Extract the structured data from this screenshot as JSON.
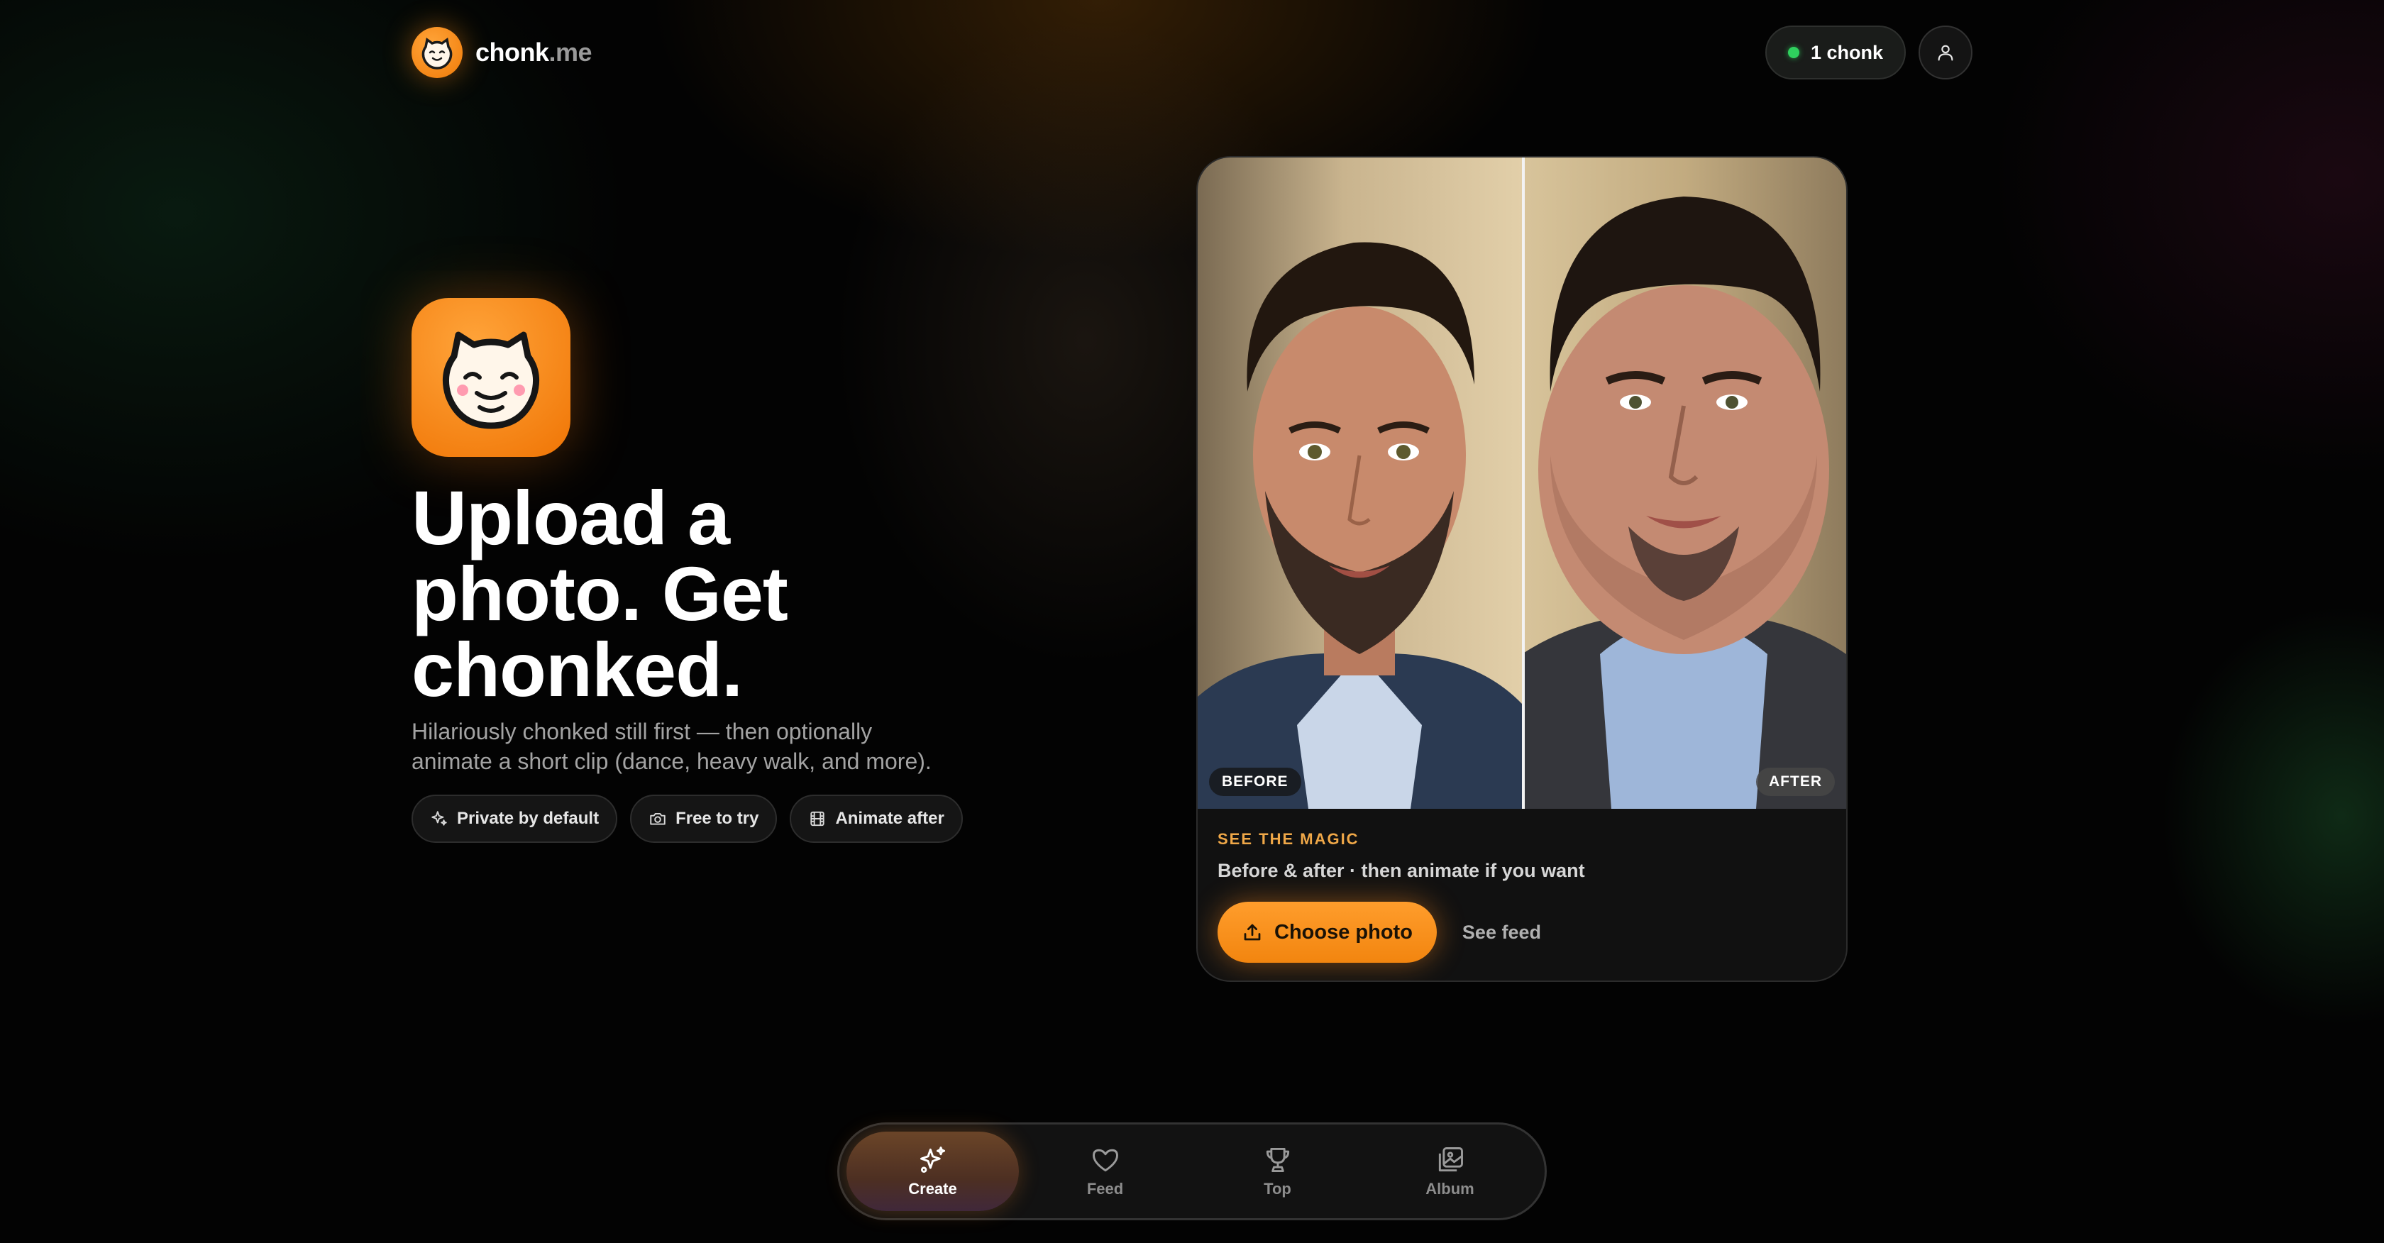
{
  "header": {
    "logo_name": "chonk",
    "logo_tld": ".me",
    "credits_label": "1 chonk",
    "status_color": "#2fd15e"
  },
  "hero": {
    "title": "Upload a photo. Get chonked.",
    "subtitle": "Hilariously chonked still first — then optionally animate a short clip (dance, heavy walk, and more).",
    "chips": [
      {
        "icon": "sparkles-icon",
        "label": "Private by default"
      },
      {
        "icon": "camera-icon",
        "label": "Free to try"
      },
      {
        "icon": "film-icon",
        "label": "Animate after"
      }
    ]
  },
  "card": {
    "before_label": "BEFORE",
    "after_label": "AFTER",
    "eyebrow": "SEE THE MAGIC",
    "caption": "Before & after · then animate if you want",
    "choose_label": "Choose photo",
    "see_feed_label": "See feed"
  },
  "nav": {
    "items": [
      {
        "label": "Create",
        "icon": "sparkles-icon",
        "active": true
      },
      {
        "label": "Feed",
        "icon": "heart-icon",
        "active": false
      },
      {
        "label": "Top",
        "icon": "trophy-icon",
        "active": false
      },
      {
        "label": "Album",
        "icon": "album-icon",
        "active": false
      }
    ]
  },
  "colors": {
    "accent": "#f28a12",
    "background": "#030303",
    "eyebrow": "#f0a848"
  }
}
